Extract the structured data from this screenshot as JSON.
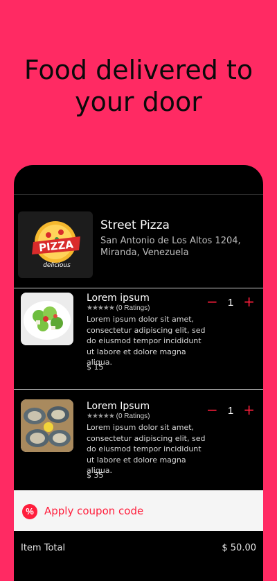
{
  "headline": "Food delivered to your door",
  "restaurant": {
    "name": "Street Pizza",
    "address": "San Antonio de Los Altos 1204, Miranda, Venezuela",
    "logo_text": "PIZZA",
    "logo_subtext": "delicious"
  },
  "items": [
    {
      "title": "Lorem ipsum",
      "stars": "★★★★★",
      "ratings": "(0 Ratings)",
      "description": "Lorem ipsum dolor sit amet, consectetur adipiscing elit, sed do eiusmod tempor incididunt ut labore et dolore magna aliqua.",
      "price": "$ 15",
      "quantity": "1",
      "minus": "−",
      "plus": "+"
    },
    {
      "title": "Lorem Ipsum",
      "stars": "★★★★★",
      "ratings": "(0 Ratings)",
      "description": "Lorem ipsum dolor sit amet, consectetur adipiscing elit, sed do eiusmod tempor incididunt ut labore et dolore magna aliqua.",
      "price": "$ 35",
      "quantity": "1",
      "minus": "−",
      "plus": "+"
    }
  ],
  "coupon": {
    "icon_symbol": "%",
    "label": "Apply coupon code"
  },
  "totals": {
    "item_total_label": "Item Total",
    "item_total_value": "$ 50.00"
  },
  "colors": {
    "background": "#FF2A63",
    "accent": "#FF1E3C",
    "card": "#000000"
  }
}
